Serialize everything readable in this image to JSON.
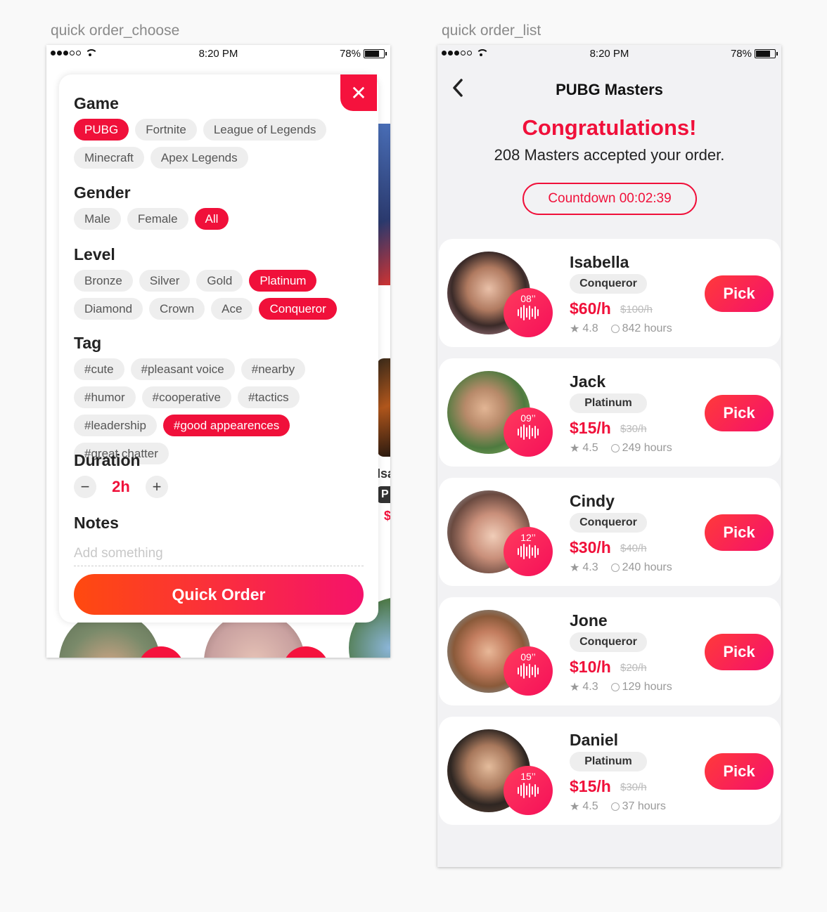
{
  "artboards": {
    "left_label": "quick order_choose",
    "right_label": "quick order_list"
  },
  "status_bar": {
    "time": "8:20 PM",
    "battery": "78%"
  },
  "choose": {
    "sections": {
      "game": "Game",
      "gender": "Gender",
      "level": "Level",
      "tag": "Tag",
      "duration": "Duration",
      "notes": "Notes"
    },
    "games": [
      {
        "label": "PUBG",
        "selected": true
      },
      {
        "label": "Fortnite",
        "selected": false
      },
      {
        "label": "League of Legends",
        "selected": false
      },
      {
        "label": "Minecraft",
        "selected": false
      },
      {
        "label": "Apex Legends",
        "selected": false
      }
    ],
    "genders": [
      {
        "label": "Male",
        "selected": false
      },
      {
        "label": "Female",
        "selected": false
      },
      {
        "label": "All",
        "selected": true
      }
    ],
    "levels": [
      {
        "label": "Bronze",
        "selected": false
      },
      {
        "label": "Silver",
        "selected": false
      },
      {
        "label": "Gold",
        "selected": false
      },
      {
        "label": "Platinum",
        "selected": true
      },
      {
        "label": "Diamond",
        "selected": false
      },
      {
        "label": "Crown",
        "selected": false
      },
      {
        "label": "Ace",
        "selected": false
      },
      {
        "label": "Conqueror",
        "selected": true
      }
    ],
    "tags": [
      {
        "label": "#cute",
        "selected": false
      },
      {
        "label": "#pleasant voice",
        "selected": false
      },
      {
        "label": "#nearby",
        "selected": false
      },
      {
        "label": "#humor",
        "selected": false
      },
      {
        "label": "#cooperative",
        "selected": false
      },
      {
        "label": "#tactics",
        "selected": false
      },
      {
        "label": "#leadership",
        "selected": false
      },
      {
        "label": "#good appearences",
        "selected": true
      },
      {
        "label": "#great chatter",
        "selected": false
      }
    ],
    "duration": {
      "minus": "−",
      "value": "2h",
      "plus": "+"
    },
    "notes_placeholder": "Add something",
    "quick_order_label": "Quick Order",
    "close_label": "✕",
    "peek_text": {
      "name": "Isa",
      "tier": "P",
      "price": "$"
    }
  },
  "list": {
    "title": "PUBG Masters",
    "congrats": "Congratulations!",
    "accepted": "208 Masters accepted your order.",
    "countdown": "Countdown 00:02:39",
    "pick_label": "Pick",
    "masters": [
      {
        "name": "Isabella",
        "tier": "Conqueror",
        "price": "$60/h",
        "old_price": "$100/h",
        "rating": "4.8",
        "hours": "842 hours",
        "voice": "08’’"
      },
      {
        "name": "Jack",
        "tier": "Platinum",
        "price": "$15/h",
        "old_price": "$30/h",
        "rating": "4.5",
        "hours": "249 hours",
        "voice": "09’’"
      },
      {
        "name": "Cindy",
        "tier": "Conqueror",
        "price": "$30/h",
        "old_price": "$40/h",
        "rating": "4.3",
        "hours": "240 hours",
        "voice": "12’’"
      },
      {
        "name": "Jone",
        "tier": "Conqueror",
        "price": "$10/h",
        "old_price": "$20/h",
        "rating": "4.3",
        "hours": "129 hours",
        "voice": "09’’"
      },
      {
        "name": "Daniel",
        "tier": "Platinum",
        "price": "$15/h",
        "old_price": "$30/h",
        "rating": "4.5",
        "hours": "37 hours",
        "voice": "15’’"
      }
    ]
  },
  "colors": {
    "accent": "#f0103a",
    "gradient_start": "#ff4a0f",
    "gradient_end": "#f5126b"
  }
}
